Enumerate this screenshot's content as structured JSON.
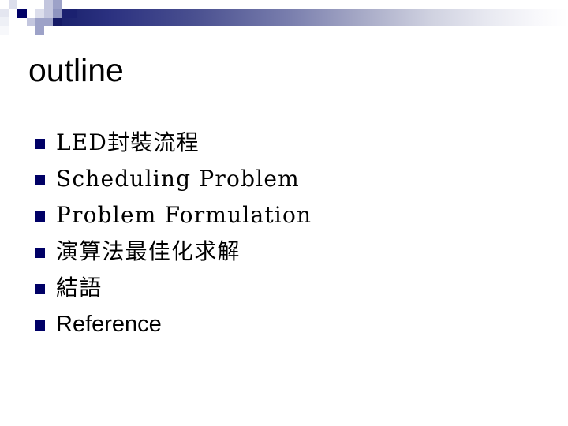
{
  "slide": {
    "title": "outline",
    "background_color": "#ffffff",
    "text_color": "#000000"
  },
  "header": {
    "accent_color": "#000066",
    "gradient_from": "#151a66",
    "gradient_to": "#ffffff",
    "checker_colors": [
      "#000066",
      "#2b3180",
      "#9da2c8",
      "#c3c6de",
      "#dcdeec",
      "#eef0f6",
      "#ffffff"
    ]
  },
  "bullets": {
    "marker_color": "#000066",
    "items": [
      {
        "label": "LED封裝流程",
        "style": "serif-mono"
      },
      {
        "label": "Scheduling Problem",
        "style": "serif-mono"
      },
      {
        "label": "Problem Formulation",
        "style": "serif-mono"
      },
      {
        "label": "演算法最佳化求解",
        "style": "serif-mono"
      },
      {
        "label": "結語",
        "style": "serif-mono"
      },
      {
        "label": "Reference",
        "style": "sans"
      }
    ]
  }
}
